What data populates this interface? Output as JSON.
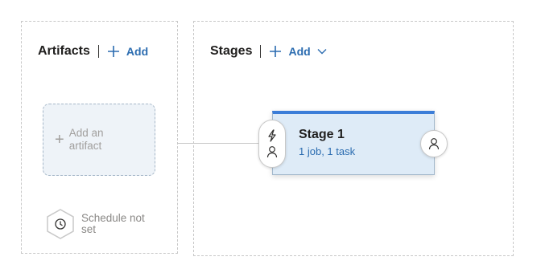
{
  "artifacts": {
    "title": "Artifacts",
    "add_label": "Add",
    "add_tile_label": "Add an artifact",
    "schedule_label": "Schedule not set"
  },
  "stages": {
    "title": "Stages",
    "add_label": "Add",
    "stage": {
      "name": "Stage 1",
      "summary": "1 job, 1 task"
    }
  },
  "icons": {
    "add": "plus-icon",
    "dropdown": "chevron-down-icon",
    "trigger": "lightning-icon",
    "approver": "person-icon",
    "schedule": "clock-icon"
  },
  "colors": {
    "accent": "#2b6cb0",
    "stage_bar": "#3b7dd8",
    "stage_bg": "#deebf7"
  }
}
